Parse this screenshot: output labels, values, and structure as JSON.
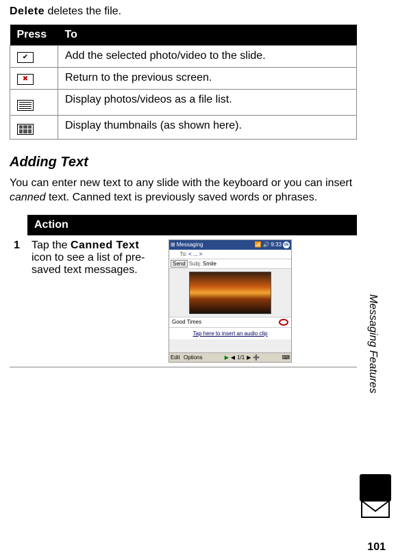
{
  "top_line": {
    "bold": "Delete",
    "rest": " deletes the file."
  },
  "press_table": {
    "headers": {
      "press": "Press",
      "to": "To"
    },
    "rows": [
      {
        "icon": "check-icon",
        "desc": "Add the selected photo/video to the slide."
      },
      {
        "icon": "x-icon",
        "desc": "Return to the previous screen."
      },
      {
        "icon": "list-icon",
        "desc": "Display photos/videos as a file list."
      },
      {
        "icon": "grid-icon",
        "desc": "Display thumbnails (as shown here)."
      }
    ]
  },
  "heading": "Adding Text",
  "paragraph": {
    "pre": "You can enter new text to any slide with the keyboard or you can insert ",
    "italic": "canned",
    "post": " text. Canned text is previously saved words or phrases."
  },
  "action_table": {
    "header": "Action",
    "step_num": "1",
    "step_pre": "Tap the ",
    "step_bold": "Canned Text",
    "step_post": " icon to see a list of pre-saved text messages."
  },
  "screenshot": {
    "title": "Messaging",
    "time": "9:33",
    "ok": "ok",
    "to_label": "To:",
    "nav_arrows": "<  ...  >",
    "send": "Send",
    "subj_label": "Subj:",
    "subj_value": "Smile",
    "caption": "Good Times",
    "audio_link": "Tap here to insert an audio clip",
    "edit": "Edit",
    "options": "Options",
    "pager": "1/1"
  },
  "side_label": "Messaging Features",
  "page_number": "101"
}
